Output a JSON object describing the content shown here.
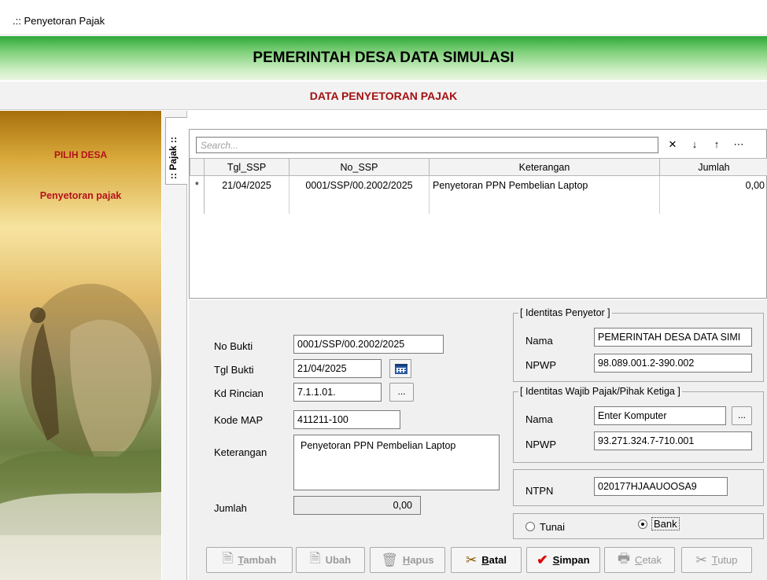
{
  "window": {
    "title": ".:: Penyetoran Pajak"
  },
  "banner": {
    "title": "PEMERINTAH DESA DATA SIMULASI"
  },
  "subheader": {
    "title": "DATA PENYETORAN PAJAK"
  },
  "left_panel": {
    "label_1": "PILIH DESA",
    "label_2": "Penyetoran pajak"
  },
  "side_tab": {
    "label": ":: Pajak ::"
  },
  "grid": {
    "search_placeholder": "Search...",
    "toolbar_icons": [
      "close-icon",
      "arrow-down-icon",
      "arrow-up-icon",
      "more-icon"
    ],
    "toolbar_glyphs": {
      "clear": "✕",
      "down": "↓",
      "up": "↑",
      "more": "⋯"
    },
    "columns": [
      "Tgl_SSP",
      "No_SSP",
      "Keterangan",
      "Jumlah"
    ],
    "rows": [
      {
        "marker": "*",
        "tgl_ssp": "21/04/2025",
        "no_ssp": "0001/SSP/00.2002/2025",
        "keterangan": "Penyetoran PPN Pembelian Laptop",
        "jumlah": "0,00"
      }
    ]
  },
  "form": {
    "no_bukti": {
      "label": "No Bukti",
      "value": "0001/SSP/00.2002/2025"
    },
    "tgl_bukti": {
      "label": "Tgl Bukti",
      "value": "21/04/2025"
    },
    "kd_rincian": {
      "label": "Kd Rincian",
      "value": "7.1.1.01.",
      "button": "..."
    },
    "kode_map": {
      "label": "Kode MAP",
      "value": "411211-100"
    },
    "keterangan": {
      "label": "Keterangan",
      "value": "Penyetoran PPN Pembelian Laptop"
    },
    "jumlah": {
      "label": "Jumlah",
      "value": "0,00"
    }
  },
  "penyetor": {
    "legend": "[ Identitas Penyetor ]",
    "nama_label": "Nama",
    "nama_value": "PEMERINTAH DESA DATA SIMI",
    "npwp_label": "NPWP",
    "npwp_value": "98.089.001.2-390.002"
  },
  "wajib_pajak": {
    "legend": "[ Identitas Wajib Pajak/Pihak Ketiga ]",
    "nama_label": "Nama",
    "nama_value": "Enter Komputer",
    "button": "...",
    "npwp_label": "NPWP",
    "npwp_value": "93.271.324.7-710.001"
  },
  "ntpn": {
    "label": "NTPN",
    "value": "020177HJAAUOOSA9"
  },
  "payment": {
    "option_1": "Tunai",
    "option_2": "Bank",
    "selected": "Bank"
  },
  "buttons": {
    "tambah": {
      "label": "Tambah",
      "underline": "T",
      "rest": "ambah",
      "enabled": false
    },
    "ubah": {
      "label": "Ubah",
      "enabled": false
    },
    "hapus": {
      "label": "Hapus",
      "underline": "H",
      "rest": "apus",
      "enabled": false
    },
    "batal": {
      "label": "Batal",
      "underline": "B",
      "rest": "atal",
      "enabled": true
    },
    "simpan": {
      "label": "Simpan",
      "underline": "S",
      "rest": "impan",
      "enabled": true
    },
    "cetak": {
      "label": "Cetak",
      "underline": "C",
      "rest": "etak",
      "enabled": false
    },
    "tutup": {
      "label": "Tutup",
      "underline": "T",
      "rest": "utup",
      "enabled": false
    }
  },
  "colors": {
    "title_red": "#a31010",
    "panel_red": "#b4121b",
    "banner_green": "#2ea83a",
    "check_red": "#e10000"
  }
}
